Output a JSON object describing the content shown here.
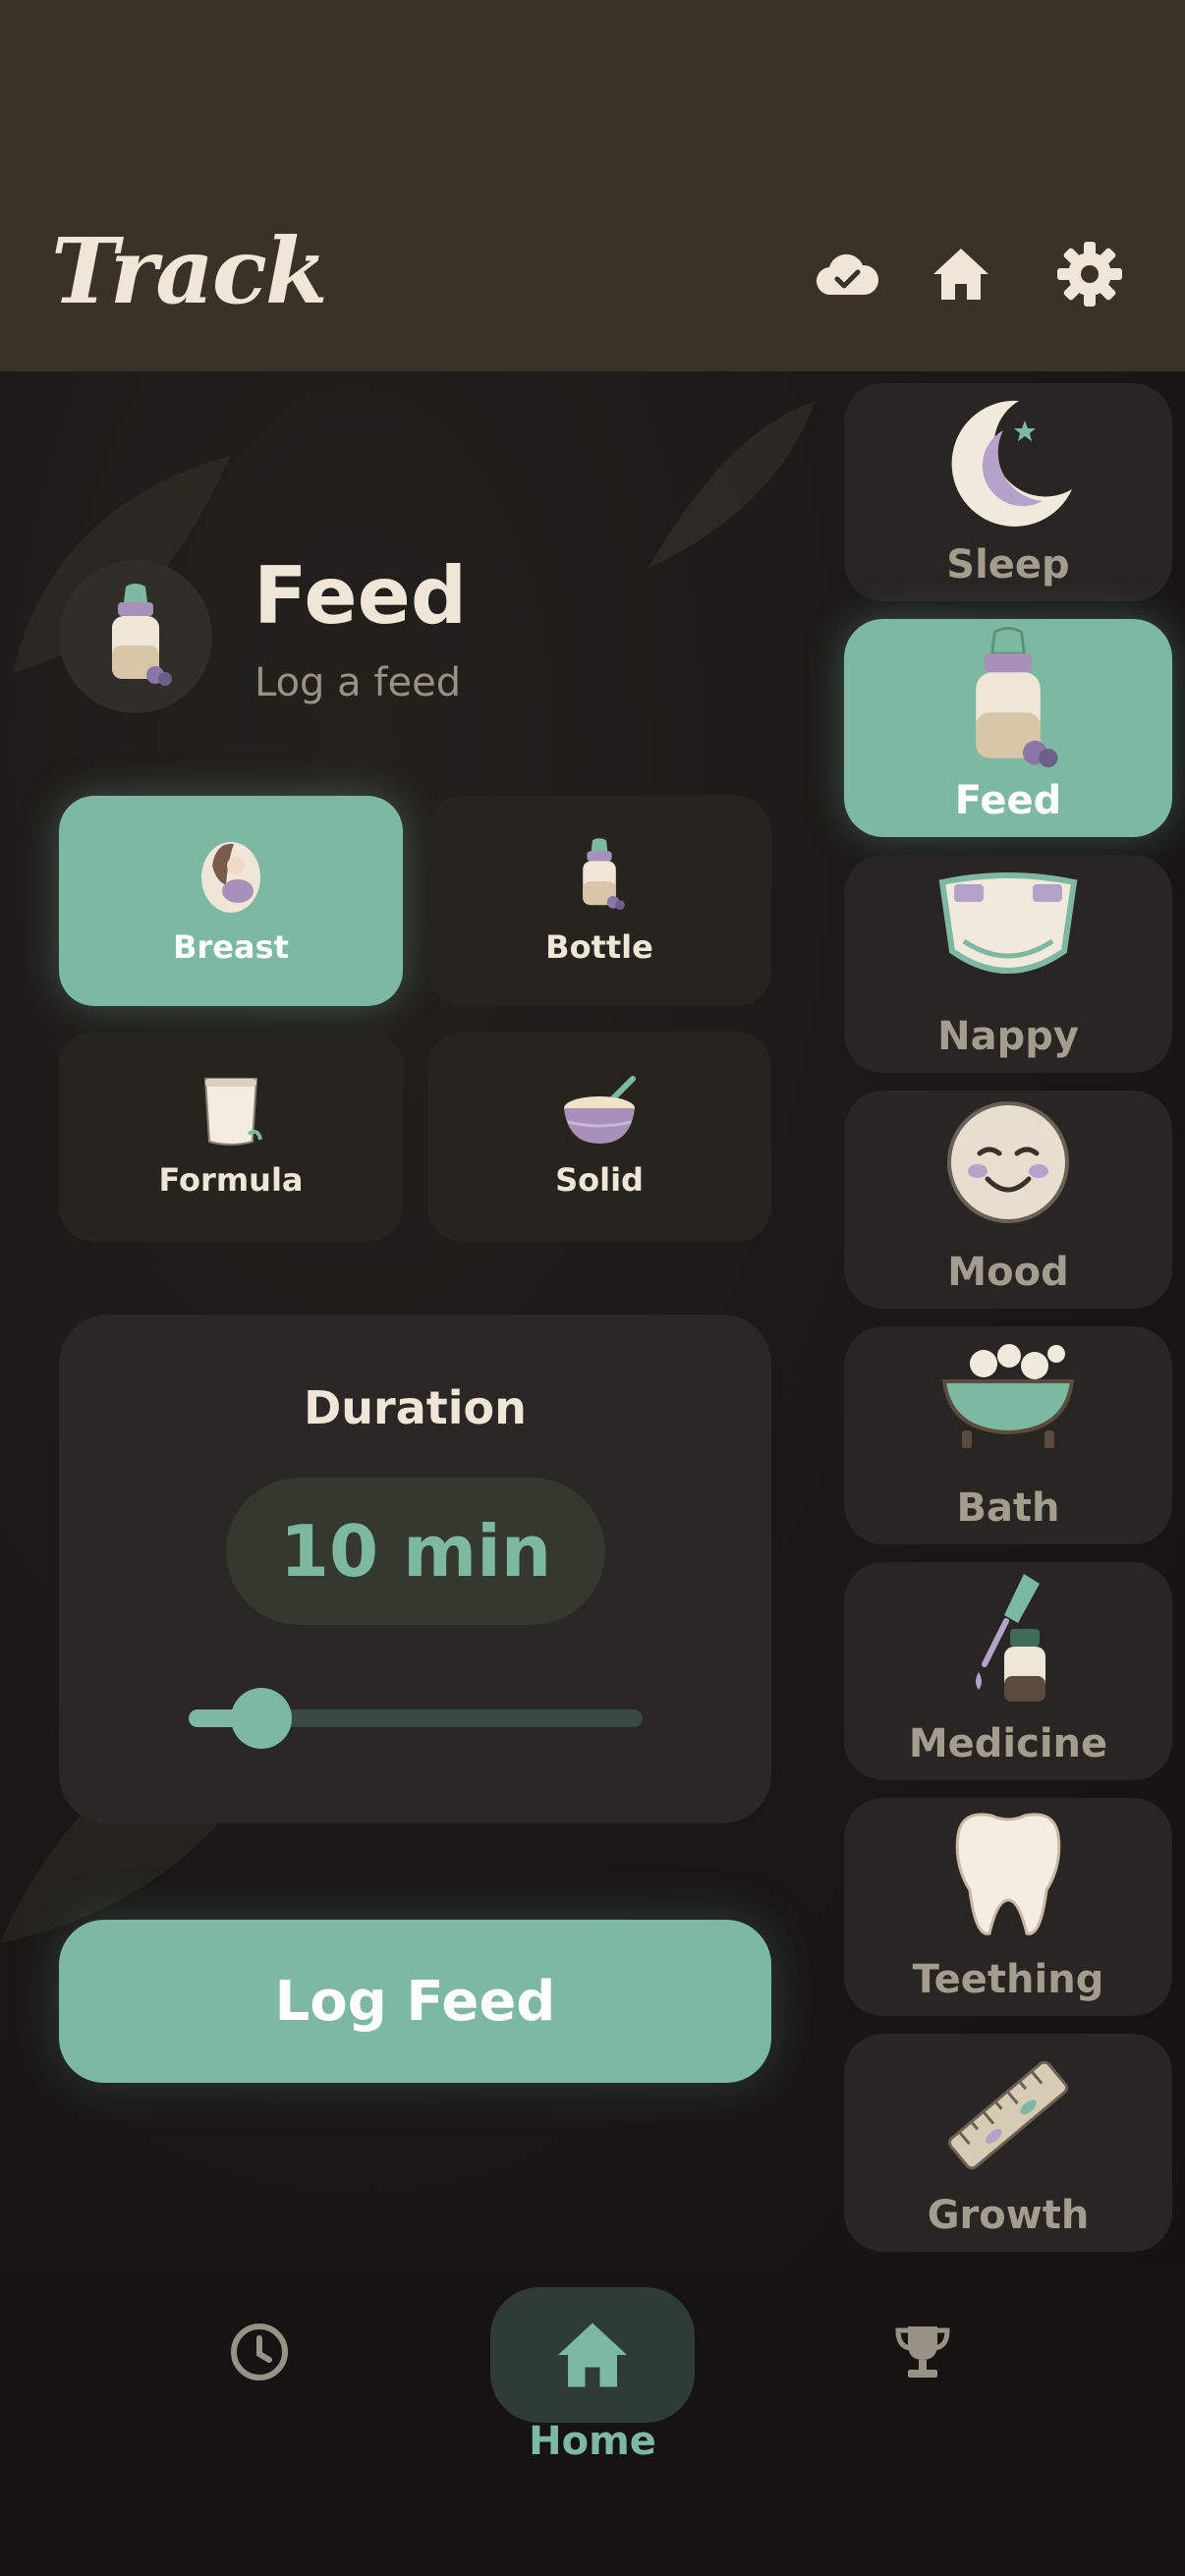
{
  "app": {
    "title": "Track",
    "accent": "#7db9a0",
    "icons": [
      "cloud-check-icon",
      "home-icon",
      "gear-icon"
    ]
  },
  "feed": {
    "title": "Feed",
    "subtitle": "Log a feed",
    "types": [
      {
        "label": "Breast",
        "icon": "breastfeeding-icon",
        "active": true
      },
      {
        "label": "Bottle",
        "icon": "bottle-icon",
        "active": false
      },
      {
        "label": "Formula",
        "icon": "formula-glass-icon",
        "active": false
      },
      {
        "label": "Solid",
        "icon": "bowl-icon",
        "active": false
      }
    ],
    "duration": {
      "label": "Duration",
      "value_text": "10 min",
      "value_minutes": 10,
      "slider_fraction": 0.16
    },
    "log_button": "Log Feed"
  },
  "categories": [
    {
      "label": "Sleep",
      "icon": "moon-icon",
      "active": false
    },
    {
      "label": "Feed",
      "icon": "bottle-icon",
      "active": true
    },
    {
      "label": "Nappy",
      "icon": "nappy-icon",
      "active": false
    },
    {
      "label": "Mood",
      "icon": "smiley-face-icon",
      "active": false
    },
    {
      "label": "Bath",
      "icon": "bathtub-icon",
      "active": false
    },
    {
      "label": "Medicine",
      "icon": "dropper-bottle-icon",
      "active": false
    },
    {
      "label": "Teething",
      "icon": "tooth-icon",
      "active": false
    },
    {
      "label": "Growth",
      "icon": "ruler-icon",
      "active": false
    }
  ],
  "bottom_nav": {
    "items": [
      {
        "name": "history",
        "icon": "clock-icon"
      },
      {
        "name": "home",
        "icon": "home-icon",
        "label": "Home",
        "active": true
      },
      {
        "name": "achievements",
        "icon": "trophy-icon"
      }
    ]
  }
}
